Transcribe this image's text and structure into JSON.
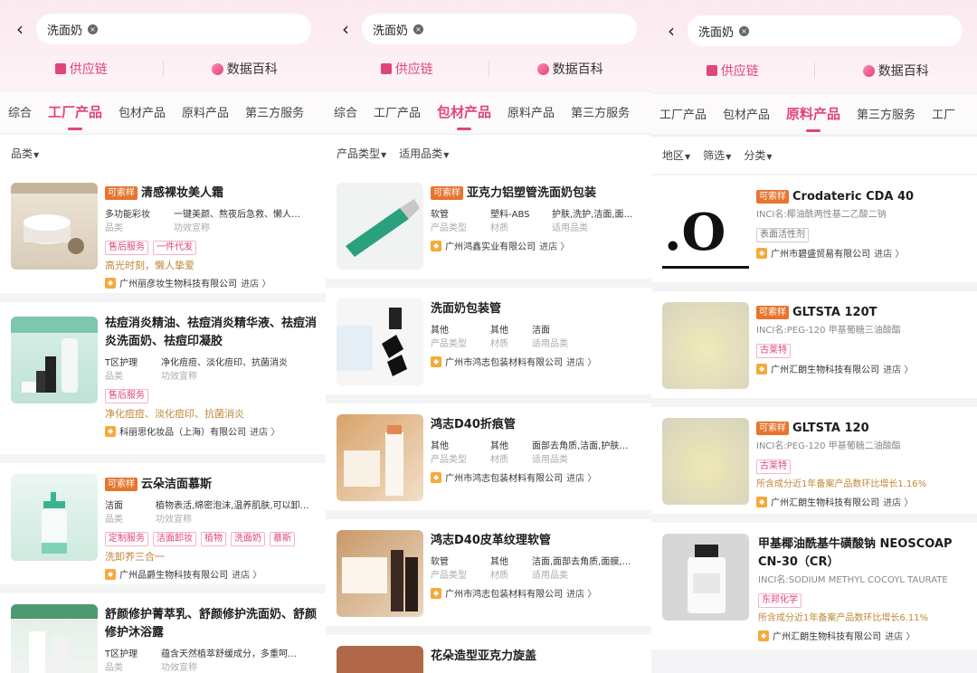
{
  "colors": {
    "accent": "#e0457b",
    "sample_tag": "#e8742e",
    "note": "#c0883a"
  },
  "panels": [
    {
      "search": "洗面奶",
      "sources": [
        "供应链",
        "数据百科"
      ],
      "tabs": [
        "综合",
        "工厂产品",
        "包材产品",
        "原料产品",
        "第三方服务"
      ],
      "active_tab": 1,
      "filters": [
        "品类"
      ],
      "cards": [
        {
          "sample": "可索样",
          "title": "清感裸妆美人霜",
          "attrs": [
            {
              "v": "多功能彩妆",
              "k": "品类"
            },
            {
              "v": "一键美颜、熬夜后急救、懒人…",
              "k": "功效宣称"
            }
          ],
          "chips": [
            "售后服务",
            "一件代发"
          ],
          "note": "高光时刻，懒人挚爱",
          "company": "广州丽彦妆生物科技有限公司",
          "store": "进店 〉"
        },
        {
          "sample": "",
          "title": "祛痘消炎精油、祛痘消炎精华液、祛痘消炎洗面奶、祛痘印凝胶",
          "attrs": [
            {
              "v": "T区护理",
              "k": "品类"
            },
            {
              "v": "净化痘痘、淡化痘印、抗菌消炎",
              "k": "功效宣称"
            }
          ],
          "chips": [
            "售后服务"
          ],
          "note": "净化痘痘、淡化痘印、抗菌消炎",
          "company": "科丽思化妆品（上海）有限公司",
          "store": "进店 〉"
        },
        {
          "sample": "可索样",
          "title": "云朵洁面慕斯",
          "attrs": [
            {
              "v": "洁面",
              "k": "品类"
            },
            {
              "v": "植物表活,绵密泡沫,温养肌肤,可以卸…",
              "k": "功效宣称"
            }
          ],
          "chips": [
            "定制服务",
            "洁面卸妆",
            "植物",
            "洗面奶",
            "慕斯"
          ],
          "note": "洗卸养三合一",
          "company": "广州品爵生物科技有限公司",
          "store": "进店 〉"
        },
        {
          "sample": "",
          "title": "舒颜修护菁萃乳、舒颜修护洗面奶、舒颜修护沐浴露",
          "attrs": [
            {
              "v": "T区护理",
              "k": "品类"
            },
            {
              "v": "蕴含天然植萃舒缓成分，多重呵…",
              "k": "功效宣称"
            }
          ],
          "chips": [],
          "note": "",
          "company": "",
          "store": ""
        }
      ]
    },
    {
      "search": "洗面奶",
      "sources": [
        "供应链",
        "数据百科"
      ],
      "tabs": [
        "综合",
        "工厂产品",
        "包材产品",
        "原料产品",
        "第三方服务"
      ],
      "active_tab": 2,
      "filters": [
        "产品类型",
        "适用品类"
      ],
      "cards": [
        {
          "sample": "可索样",
          "title": "亚克力铝塑管洗面奶包装",
          "attrs": [
            {
              "v": "软管",
              "k": "产品类型"
            },
            {
              "v": "塑料-ABS",
              "k": "材质"
            },
            {
              "v": "护肤,洗护,洁面,面…",
              "k": "适用品类"
            }
          ],
          "company": "广州鸿鑫实业有限公司",
          "store": "进店 〉"
        },
        {
          "sample": "",
          "title": "洗面奶包装管",
          "attrs": [
            {
              "v": "其他",
              "k": "产品类型"
            },
            {
              "v": "其他",
              "k": "材质"
            },
            {
              "v": "洁面",
              "k": "适用品类"
            }
          ],
          "company": "广州市鸿志包装材料有限公司",
          "store": "进店 〉"
        },
        {
          "sample": "",
          "title": "鸿志D40折痕管",
          "attrs": [
            {
              "v": "其他",
              "k": "产品类型"
            },
            {
              "v": "其他",
              "k": "材质"
            },
            {
              "v": "面部去角质,洁面,护肤…",
              "k": "适用品类"
            }
          ],
          "company": "广州市鸿志包装材料有限公司",
          "store": "进店 〉"
        },
        {
          "sample": "",
          "title": "鸿志D40皮革纹理软管",
          "attrs": [
            {
              "v": "软管",
              "k": "产品类型"
            },
            {
              "v": "其他",
              "k": "材质"
            },
            {
              "v": "洁面,面部去角质,面膜,…",
              "k": "适用品类"
            }
          ],
          "company": "广州市鸿志包装材料有限公司",
          "store": "进店 〉"
        },
        {
          "sample": "",
          "title": "花朵造型亚克力旋盖",
          "attrs": [],
          "company": "",
          "store": ""
        }
      ]
    },
    {
      "search": "洗面奶",
      "sources": [
        "供应链",
        "数据百科"
      ],
      "tabs": [
        "工厂产品",
        "包材产品",
        "原料产品",
        "第三方服务",
        "工厂"
      ],
      "active_tab": 2,
      "filters": [
        "地区",
        "筛选",
        "分类"
      ],
      "cards": [
        {
          "sample": "可索样",
          "title": "Crodateric CDA 40",
          "inci": "INCI名:椰油酰两性基二乙酸二钠",
          "chips": [
            "表面活性剂"
          ],
          "note": "",
          "company": "广州市碧盛贸易有限公司",
          "store": "进店 〉"
        },
        {
          "sample": "可索样",
          "title": "GLTSTA 120T",
          "inci": "INCI名:PEG-120 甲基葡糖三油酸酯",
          "chips": [
            "古莱特"
          ],
          "note": "",
          "company": "广州汇朗生物科技有限公司",
          "store": "进店 〉"
        },
        {
          "sample": "可索样",
          "title": "GLTSTA 120",
          "inci": "INCI名:PEG-120 甲基葡糖二油酸酯",
          "chips": [
            "古莱特"
          ],
          "note": "所含成分近1年备案产品数环比增长1.16%",
          "company": "广州汇朗生物科技有限公司",
          "store": "进店 〉"
        },
        {
          "sample": "",
          "title": "甲基椰油酰基牛磺酸钠 NEOSCOAP CN-30（CR）",
          "inci": "INCI名:SODIUM METHYL COCOYL TAURATE",
          "chips": [
            "东邦化学"
          ],
          "note": "所含成分近1年备案产品数环比增长6.11%",
          "company": "广州汇朗生物科技有限公司",
          "store": "进店 〉"
        }
      ]
    }
  ]
}
